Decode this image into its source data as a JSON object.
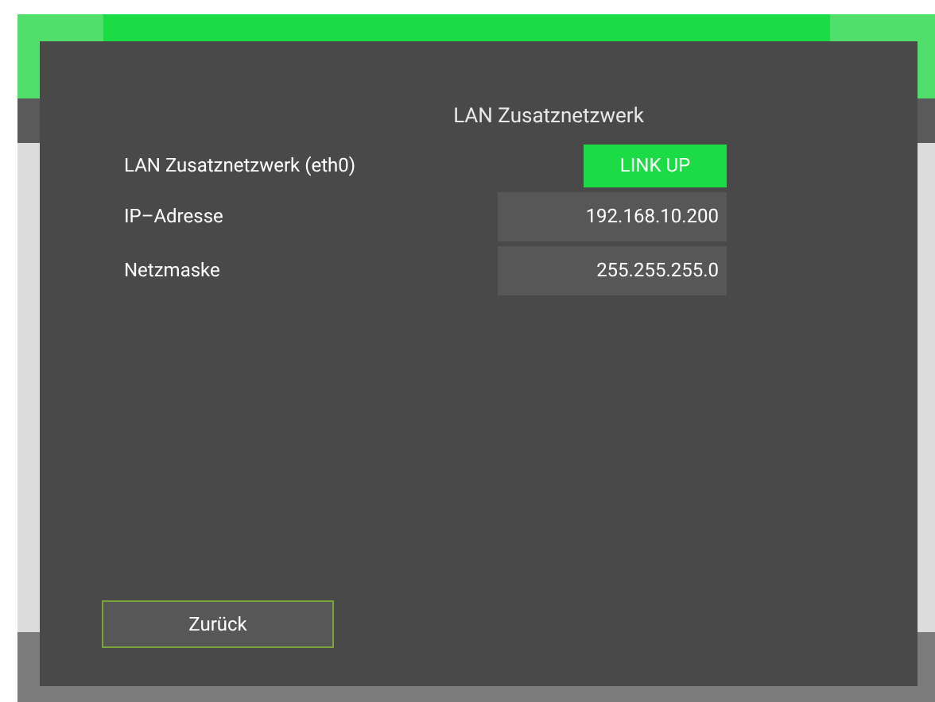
{
  "dialog": {
    "title": "LAN Zusatznetzwerk",
    "rows": [
      {
        "kind": "status",
        "label": "LAN Zusatznetzwerk (eth0)",
        "value": "LINK UP",
        "on": true
      },
      {
        "kind": "field",
        "label": "IP–Adresse",
        "value": "192.168.10.200"
      },
      {
        "kind": "field",
        "label": "Netzmaske",
        "value": "255.255.255.0"
      }
    ],
    "back_button": "Zurück"
  }
}
